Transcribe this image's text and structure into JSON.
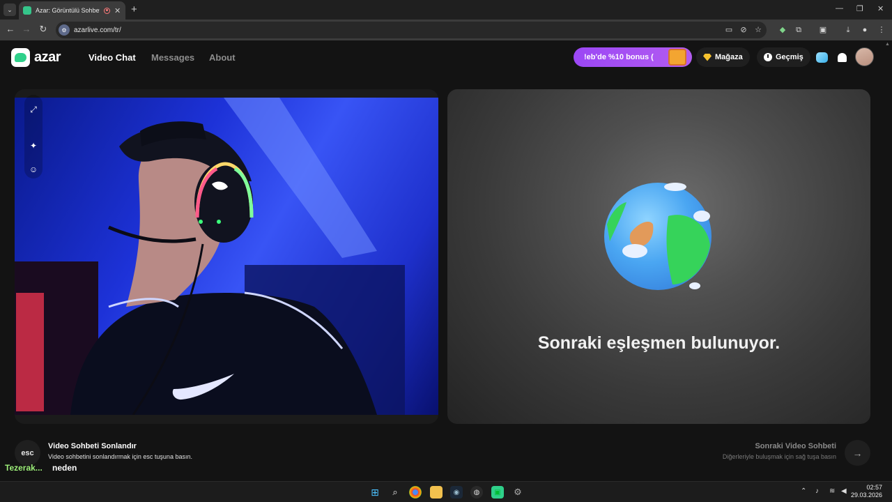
{
  "browser": {
    "tab_title": "Azar: Görüntülü Sohbet & V",
    "tab_close": "✕",
    "new_tab": "+",
    "url": "azarlive.com/tr/",
    "window_controls": [
      "—",
      "❐",
      "✕"
    ]
  },
  "header": {
    "brand": "azar",
    "nav": [
      "Video Chat",
      "Messages",
      "About"
    ],
    "promo": "!eb'de %10 bonus (",
    "shop": "Mağaza",
    "history": "Geçmiş"
  },
  "match": {
    "status": "Sonraki eşleşmen bulunuyor."
  },
  "controls": {
    "end_key": "esc",
    "end_title": "Video Sohbeti Sonlandır",
    "end_desc": "Video sohbetini sonlandırmak için esc tuşuna basın.",
    "next_title": "Sonraki Video Sohbeti",
    "next_desc": "Diğerleriyle buluşmak için sağ tuşa basın",
    "next_arrow": "→"
  },
  "overlay": {
    "name": "Tezerak...",
    "message": "neden"
  },
  "taskbar": {
    "time": "02:57",
    "date": "29.03.2026"
  },
  "colors": {
    "accent": "#2fd08a",
    "promo": "#a852f3",
    "overlay_name": "#9ef07a"
  }
}
